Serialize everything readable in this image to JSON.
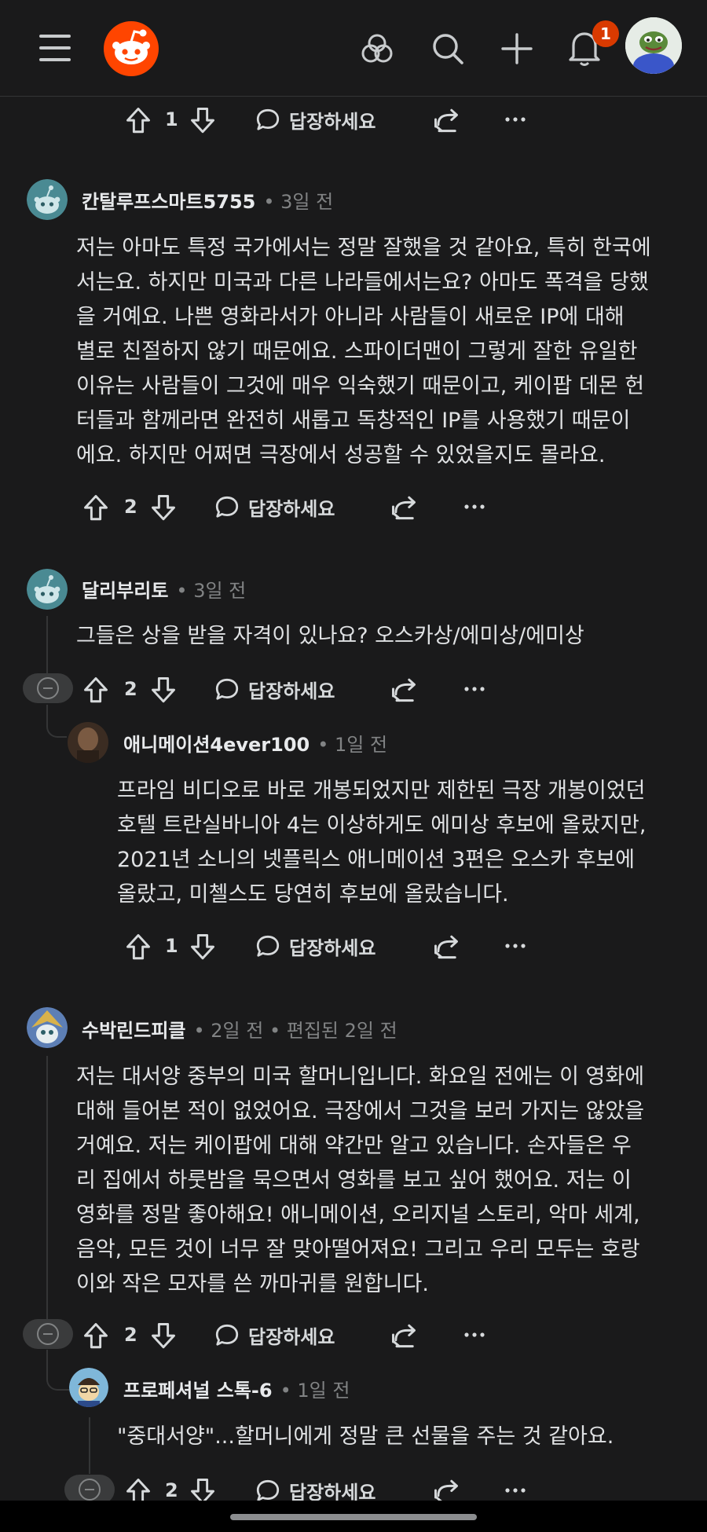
{
  "topbar": {
    "menu_icon": "hamburger-icon",
    "logo_icon": "reddit-logo",
    "communities_icon": "communities-icon",
    "search_icon": "search-icon",
    "create_icon": "plus-icon",
    "notifications_icon": "bell-icon",
    "notification_count": "1",
    "avatar_icon": "user-avatar"
  },
  "comments": [
    {
      "actions": {
        "count": "1",
        "reply": "답장하세요"
      }
    },
    {
      "author": "칸탈루프스마트5755",
      "meta": "• 3일 전",
      "body": [
        "저는 아마도 특정 국가에서는 정말 잘했을 것 같아요, 특히 한국에",
        "서는요. 하지만 미국과 다른 나라들에서는요? 아마도 폭격을 당했",
        "을 거예요. 나쁜 영화라서가 아니라 사람들이 새로운 IP에 대해",
        "별로 친절하지 않기 때문에요. 스파이더맨이 그렇게 잘한 유일한",
        "이유는 사람들이 그것에 매우 익숙했기 때문이고, 케이팝 데몬 헌",
        "터들과 함께라면 완전히 새롭고 독창적인 IP를 사용했기 때문이",
        "에요. 하지만 어쩌면 극장에서 성공할 수 있었을지도 몰라요."
      ],
      "actions": {
        "count": "2",
        "reply": "답장하세요"
      }
    },
    {
      "author": "달리부리토",
      "meta": "• 3일 전",
      "body": [
        "그들은 상을 받을 자격이 있나요? 오스카상/에미상/에미상"
      ],
      "actions": {
        "count": "2",
        "reply": "답장하세요"
      }
    },
    {
      "author": "애니메이션4ever100",
      "meta": "• 1일 전",
      "body": [
        "프라임 비디오로 바로 개봉되었지만 제한된 극장 개봉이었던",
        "호텔 트란실바니아 4는 이상하게도 에미상 후보에 올랐지만,",
        "2021년 소니의 넷플릭스 애니메이션 3편은 오스카 후보에",
        "올랐고, 미첼스도 당연히 후보에 올랐습니다."
      ],
      "actions": {
        "count": "1",
        "reply": "답장하세요"
      }
    },
    {
      "author": "수박린드피클",
      "meta": "• 2일 전 • 편집된 2일 전",
      "body": [
        "저는 대서양 중부의 미국 할머니입니다. 화요일 전에는 이 영화에",
        "대해 들어본 적이 없었어요. 극장에서 그것을 보러 가지는 않았을",
        "거예요. 저는 케이팝에 대해 약간만 알고 있습니다. 손자들은 우",
        "리 집에서 하룻밤을 묵으면서 영화를 보고 싶어 했어요. 저는 이",
        "영화를 정말 좋아해요! 애니메이션, 오리지널 스토리, 악마 세계,",
        "음악, 모든 것이 너무 잘 맞아떨어져요! 그리고 우리 모두는 호랑",
        "이와 작은 모자를 쓴 까마귀를 원합니다."
      ],
      "actions": {
        "count": "2",
        "reply": "답장하세요"
      }
    },
    {
      "author": "프로페셔널 스톡-6",
      "meta": "• 1일 전",
      "body": [
        "\"중대서양\"...할머니에게 정말 큰 선물을 주는 것 같아요."
      ],
      "actions": {
        "count": "2",
        "reply": "답장하세요"
      }
    }
  ]
}
